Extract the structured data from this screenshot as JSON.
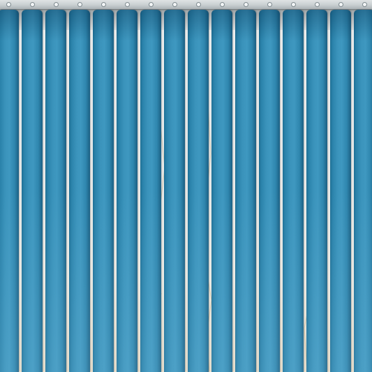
{
  "image": {
    "subject": "",
    "colors": {
      "slat": "#2f88b0",
      "slat_dark": "#1b5f82",
      "headrail": "#c9cfd1",
      "window_light": "#f1f3f3"
    }
  }
}
